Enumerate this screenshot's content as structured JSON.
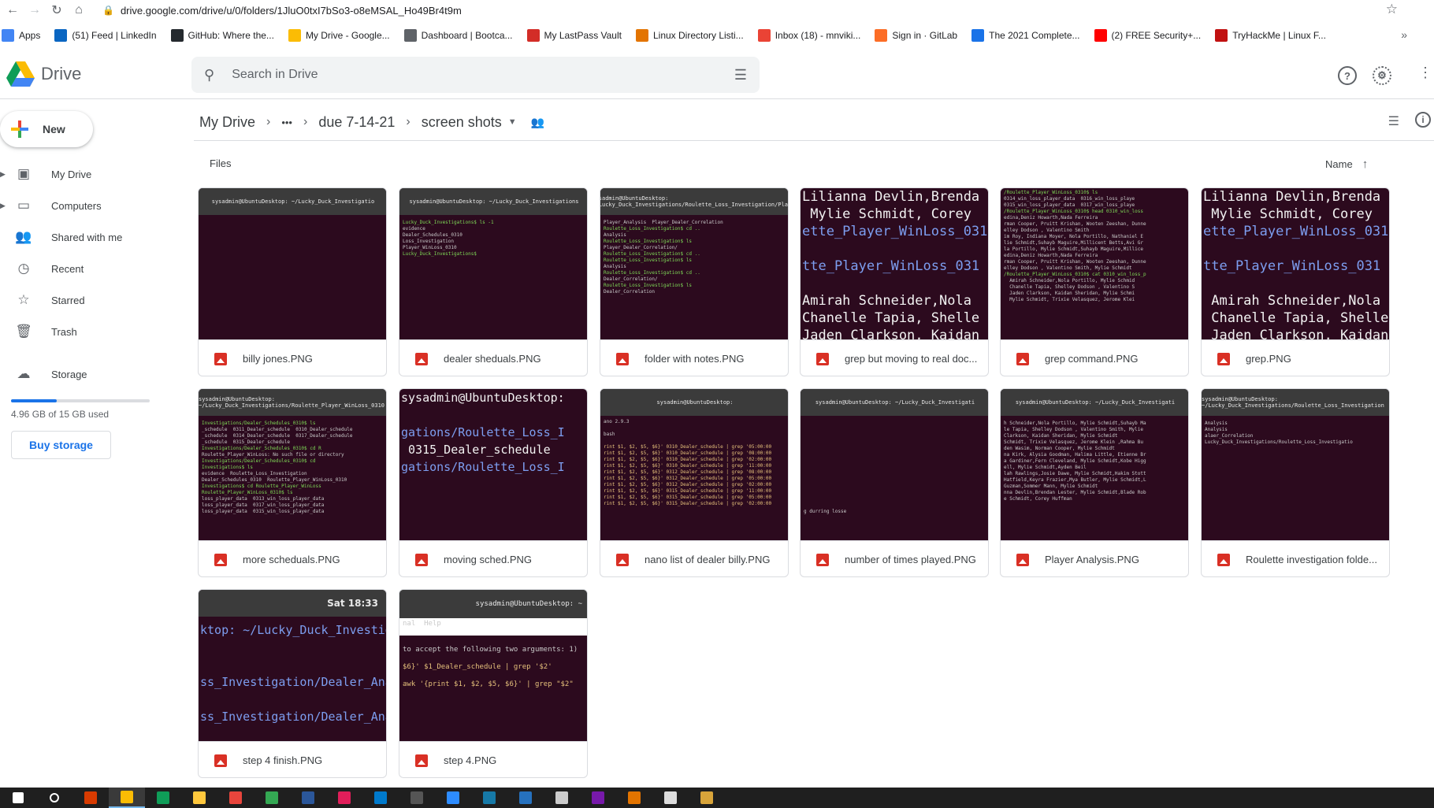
{
  "browser": {
    "url": "drive.google.com/drive/u/0/folders/1JluO0txI7bSo3-o8eMSAL_Ho49Br4t9m",
    "bookmarks": [
      {
        "label": "Apps",
        "icon": "apps-grid-icon",
        "color": "#4285f4"
      },
      {
        "label": "(51) Feed | LinkedIn",
        "icon": "linkedin-icon",
        "color": "#0a66c2"
      },
      {
        "label": "GitHub: Where the...",
        "icon": "github-icon",
        "color": "#24292e"
      },
      {
        "label": "My Drive - Google...",
        "icon": "drive-icon",
        "color": "#fbbc04"
      },
      {
        "label": "Dashboard | Bootca...",
        "icon": "globe-icon",
        "color": "#5f6368"
      },
      {
        "label": "My LastPass Vault",
        "icon": "lastpass-icon",
        "color": "#d32d27"
      },
      {
        "label": "Linux Directory Listi...",
        "icon": "linux-icon",
        "color": "#e37400"
      },
      {
        "label": "Inbox (18) - mnviki...",
        "icon": "gmail-icon",
        "color": "#ea4335"
      },
      {
        "label": "Sign in · GitLab",
        "icon": "gitlab-icon",
        "color": "#fc6d26"
      },
      {
        "label": "The 2021 Complete...",
        "icon": "list-icon",
        "color": "#1a73e8"
      },
      {
        "label": "(2) FREE Security+...",
        "icon": "youtube-icon",
        "color": "#ff0000"
      },
      {
        "label": "TryHackMe | Linux F...",
        "icon": "tryhackme-icon",
        "color": "#c11111"
      }
    ]
  },
  "app": {
    "name": "Drive",
    "search_placeholder": "Search in Drive"
  },
  "sidebar": {
    "new_label": "New",
    "items": [
      {
        "label": "My Drive",
        "icon": "my-drive-icon",
        "glyph": "▣",
        "expandable": true
      },
      {
        "label": "Computers",
        "icon": "computers-icon",
        "glyph": "▭",
        "expandable": true
      },
      {
        "label": "Shared with me",
        "icon": "shared-icon",
        "glyph": "👥",
        "expandable": false
      },
      {
        "label": "Recent",
        "icon": "recent-icon",
        "glyph": "◷",
        "expandable": false
      },
      {
        "label": "Starred",
        "icon": "starred-icon",
        "glyph": "☆",
        "expandable": false
      },
      {
        "label": "Trash",
        "icon": "trash-icon",
        "glyph": "🗑",
        "expandable": false
      },
      {
        "label": "Storage",
        "icon": "cloud-icon",
        "glyph": "☁",
        "expandable": false
      }
    ],
    "storage_used_fraction": 0.33,
    "storage_text": "4.96 GB of 15 GB used",
    "buy_storage_label": "Buy storage"
  },
  "breadcrumb": {
    "root": "My Drive",
    "ellipsis": "•••",
    "parent": "due 7-14-21",
    "current": "screen shots"
  },
  "list": {
    "section_label": "Files",
    "sort_label": "Name"
  },
  "files": [
    {
      "name": "billy jones.PNG",
      "style": "term",
      "title": "sysadmin@UbuntuDesktop: ~/Lucky_Duck_Investigatio",
      "lines": []
    },
    {
      "name": "dealer sheduals.PNG",
      "style": "term",
      "title": "sysadmin@UbuntuDesktop: ~/Lucky_Duck_Investigations",
      "lines": [
        "Lucky_Duck_Investigations$ ls -1",
        "evidence",
        "Dealer_Schedules_0310",
        "Loss_Investigation",
        "Player_WinLoss_0310",
        "Lucky_Duck_Investigations$"
      ]
    },
    {
      "name": "folder with notes.PNG",
      "style": "term",
      "title": "sysadmin@UbuntuDesktop: ~/Lucky_Duck_Investigations/Roulette_Loss_Investigation/Pla...",
      "lines": [
        "Player_Analysis  Player_Dealer_Correlation",
        "Roulette_Loss_Investigation$ cd ..",
        "Analysis",
        "Roulette_Loss_Investigation$ ls",
        "Player_Dealer_Correlation/",
        "Roulette_Loss_Investigation$ cd ..",
        "Roulette_Loss_Investigation$ ls",
        "Analysis",
        "Roulette_Loss_Investigation$ cd ..",
        "Dealer_Correlation/",
        "Roulette_Loss_Investigation$ ls",
        "Dealer_Correlation"
      ]
    },
    {
      "name": "grep but moving to real doc...",
      "style": "big",
      "title": "",
      "lines": [
        "Lilianna Devlin,Brenda",
        " Mylie Schmidt, Corey",
        "ette_Player_WinLoss_031",
        "",
        "tte_Player_WinLoss_031",
        "",
        "Amirah Schneider,Nola",
        "Chanelle Tapia, Shelle",
        "Jaden Clarkson, Kaidan"
      ]
    },
    {
      "name": "grep command.PNG",
      "style": "term2",
      "title": "",
      "lines": [
        "/Roulette_Player_WinLoss_0310$ ls",
        "0314_win_loss_player_data  0316_win_loss_playe",
        "0315_win_loss_player_data  0317_win_loss_playe",
        "/Roulette_Player_WinLoss_0310$ head 0310_win_loss",
        "edina,Deniz Howarth,Nada Ferreira",
        "rman Cooper, Pruitt Krishan, Wooten Zeeshan, Dunne",
        "elley Dodson , Valentino Smith",
        "im Roy, Indiana Moyer, Nola Portillo, Nathaniel E",
        "lie Schmidt,Suhayb Maguire,Millicent Betts,Avi Gr",
        "la Portillo, Mylie Schmidt,Suhayb Maguire,Millice",
        "edina,Deniz Howarth,Nada Ferreira",
        "rman Cooper, Pruitt Krishan, Wooten Zeeshan, Dunne",
        "elley Dodson , Valentino Smith, Mylie Schmidt",
        "/Roulette_Player_WinLoss_0310$ cat 0310_win_loss_p",
        "  Amirah Schneider,Nola Portillo, Mylie Schmid",
        "  Chanelle Tapia, Shelley Dodson , Valentino S",
        "  Jaden Clarkson, Kaidan Sheridan, Mylie Schmi",
        "  Mylie Schmidt, Trixie Velasquez, Jerome Klei"
      ]
    },
    {
      "name": "grep.PNG",
      "style": "big",
      "title": "",
      "lines": [
        "Lilianna Devlin,Brenda",
        " Mylie Schmidt, Corey",
        "ette_Player_WinLoss_031",
        "",
        "tte_Player_WinLoss_031",
        "",
        " Amirah Schneider,Nola",
        " Chanelle Tapia, Shelle",
        " Jaden Clarkson, Kaidan"
      ]
    },
    {
      "name": "more scheduals.PNG",
      "style": "term",
      "title": "sysadmin@UbuntuDesktop: ~/Lucky_Duck_Investigations/Roulette_Player_WinLoss_0310",
      "lines": [
        "Investigations/Dealer_Schedules_0310$ ls",
        "_schedule  0311_Dealer_schedule  0310_Dealer_schedule",
        "_schedule  0314_Dealer_schedule  0317_Dealer_schedule",
        "_schedule  0315_Dealer_schedule",
        "Investigations/Dealer_Schedules_0310$ cd R",
        "Roulette_Player_WinLoss: No such file or directory",
        "Investigations/Dealer_Schedules_0310$ cd",
        "Investigations$ ls",
        "evidence  Roulette_Loss_Investigation",
        "Dealer_Schedules_0310  Roulette_Player_WinLoss_0310",
        "Investigations$ cd Roulette_Player_WinLoss",
        "Roulette_Player_WinLoss_0310$ ls",
        "loss_player_data  0313_win_loss_player_data",
        "loss_player_data  0317_win_loss_player_data",
        "loss_player_data  0315_win_loss_player_data"
      ]
    },
    {
      "name": "moving sched.PNG",
      "style": "big2",
      "title": "",
      "lines": [
        "sysadmin@UbuntuDesktop:",
        "",
        "gations/Roulette_Loss_I",
        " 0315_Dealer_schedule",
        "gations/Roulette_Loss_I"
      ]
    },
    {
      "name": "nano list of dealer billy.PNG",
      "style": "term3",
      "title": "sysadmin@UbuntuDesktop:",
      "lines": [
        "ano 2.9.3",
        "",
        "bash",
        "",
        "rint $1, $2, $5, $6}' 0310_Dealer_schedule | grep '05:00:00",
        "rint $1, $2, $5, $6}' 0310_Dealer_schedule | grep '08:00:00",
        "rint $1, $2, $5, $6}' 0310_Dealer_schedule | grep '02:00:00",
        "rint $1, $2, $5, $6}' 0310_Dealer_schedule | grep '11:00:00",
        "rint $1, $2, $5, $6}' 0312_Dealer_schedule | grep '08:00:00",
        "rint $1, $2, $5, $6}' 0312_Dealer_schedule | grep '05:00:00",
        "rint $1, $2, $5, $6}' 0312_Dealer_schedule | grep '02:00:00",
        "rint $1, $2, $5, $6}' 0315_Dealer_schedule | grep '11:00:00",
        "rint $1, $2, $5, $6}' 0315_Dealer_schedule | grep '05:00:00",
        "rint $1, $2, $5, $6}' 0315_Dealer_schedule | grep '02:00:00"
      ]
    },
    {
      "name": "number of times played.PNG",
      "style": "term",
      "title": "sysadmin@UbuntuDesktop: ~/Lucky_Duck_Investigati",
      "lines": [
        "",
        "",
        "",
        "",
        "",
        "",
        "",
        "",
        "",
        "",
        "",
        "",
        "",
        "",
        "g durring losse"
      ]
    },
    {
      "name": "Player Analysis.PNG",
      "style": "term",
      "title": "sysadmin@UbuntuDesktop: ~/Lucky_Duck_Investigati",
      "lines": [
        "h Schneider,Nola Portillo, Mylie Schmidt,Suhayb Ma",
        "le Tapia, Shelley Dodson , Valentino Smith, Mylie",
        "Clarkson, Kaidan Sheridan, Mylie Schmidt",
        "Schmidt, Trixie Velasquez, Jerome Klein ,Rahma Bu",
        "den Wasim, Norman Cooper, Mylie Schmidt",
        "na Kirk, Alysia Goodman, Halima Little, Etienne Br",
        "a Gardiner,Fern Cleveland, Mylie Schmidt,Kobe Higg",
        "ell, Mylie Schmidt,Ayden Beil",
        "lah Rawlings,Josie Dawe, Mylie Schmidt,Hakim Stott",
        "Hatfield,Keyra Frazier,Mya Butler, Mylie Schmidt,L",
        "Guzman,Sommer Mann, Mylie Schmidt",
        "nna Devlin,Brendan Lester, Mylie Schmidt,Blade Rob",
        "e Schmidt, Corey Huffman"
      ]
    },
    {
      "name": "Roulette investigation folde...",
      "style": "term",
      "title": "sysadmin@UbuntuDesktop: ~/Lucky_Duck_Investigations/Roulette_Loss_Investigation",
      "lines": [
        "Analysis",
        "Analysis",
        "alaer_Correlation",
        "Lucky_Duck_Investigations/Roulette_Loss_Investigatio"
      ]
    },
    {
      "name": "step 4 finish.PNG",
      "style": "big3",
      "title": "Sat 18:33",
      "lines": [
        "ktop: ~/Lucky_Duck_Investigations/Ro",
        "",
        "",
        "ss_Investigation/Dealer_Analys",
        "",
        "ss_Investigation/Dealer_Analys"
      ]
    },
    {
      "name": "step 4.PNG",
      "style": "step4",
      "title": "sysadmin@UbuntuDesktop: ~",
      "lines": [
        "nal  Help",
        "",
        "",
        "to accept the following two arguments: 1)",
        "",
        "$6}' $1_Dealer_schedule | grep '$2'",
        "",
        "awk '{print $1, $2, $5, $6}' | grep \"$2\""
      ]
    }
  ],
  "taskbar": [
    {
      "icon": "windows-start-icon",
      "color": "#ffffff"
    },
    {
      "icon": "search-icon",
      "color": "#ffffff"
    },
    {
      "icon": "office-icon",
      "color": "#d83b01"
    },
    {
      "icon": "chrome-icon",
      "color": "#fbbc04"
    },
    {
      "icon": "edge-icon",
      "color": "#0f9d58"
    },
    {
      "icon": "file-explorer-icon",
      "color": "#ffc83d"
    },
    {
      "icon": "snip-icon",
      "color": "#e8453c"
    },
    {
      "icon": "edge-green-icon",
      "color": "#34a853"
    },
    {
      "icon": "word-icon",
      "color": "#2b579a"
    },
    {
      "icon": "slack-icon",
      "color": "#e01e5a"
    },
    {
      "icon": "vscode-icon",
      "color": "#007acc"
    },
    {
      "icon": "kali-icon",
      "color": "#555555"
    },
    {
      "icon": "zoom-icon",
      "color": "#2d8cff"
    },
    {
      "icon": "wireshark-icon",
      "color": "#1679a7"
    },
    {
      "icon": "powershell-icon",
      "color": "#2671be"
    },
    {
      "icon": "virtualbox-icon",
      "color": "#cccccc"
    },
    {
      "icon": "onenote-icon",
      "color": "#7719aa"
    },
    {
      "icon": "calculator-icon",
      "color": "#e37400"
    },
    {
      "icon": "7zip-icon",
      "color": "#dddddd"
    },
    {
      "icon": "app-icon",
      "color": "#d8a43a"
    }
  ]
}
